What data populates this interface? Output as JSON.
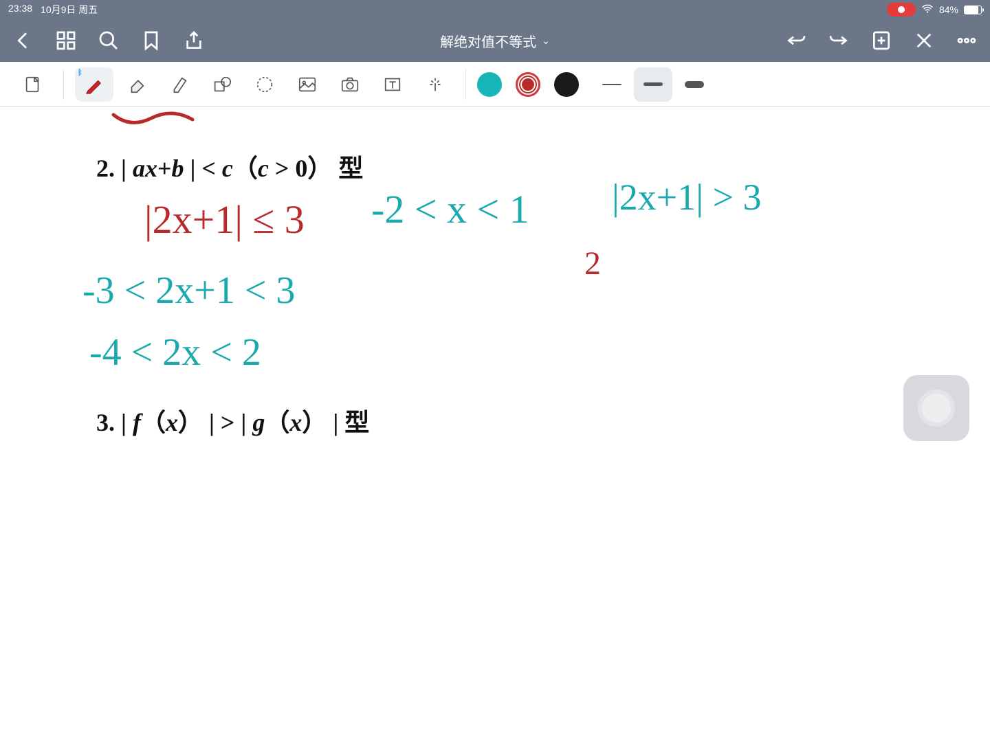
{
  "status": {
    "time": "23:38",
    "date": "10月9日 周五",
    "battery_pct": "84%"
  },
  "title": "解绝对值不等式",
  "canvas": {
    "line2_title": "2. | ax+b | < c（c > 0） 型",
    "line3_title": "3. | f（x） | > | g（x） | 型",
    "red_eq1": "|2x+1| ≤ 3",
    "teal_eq1": "-2 < x < 1",
    "teal_eq2": "|2x+1| > 3",
    "teal_eq3": "-3 < 2x+1 < 3",
    "teal_eq4": "-4 < 2x < 2",
    "red_frag": "2"
  }
}
